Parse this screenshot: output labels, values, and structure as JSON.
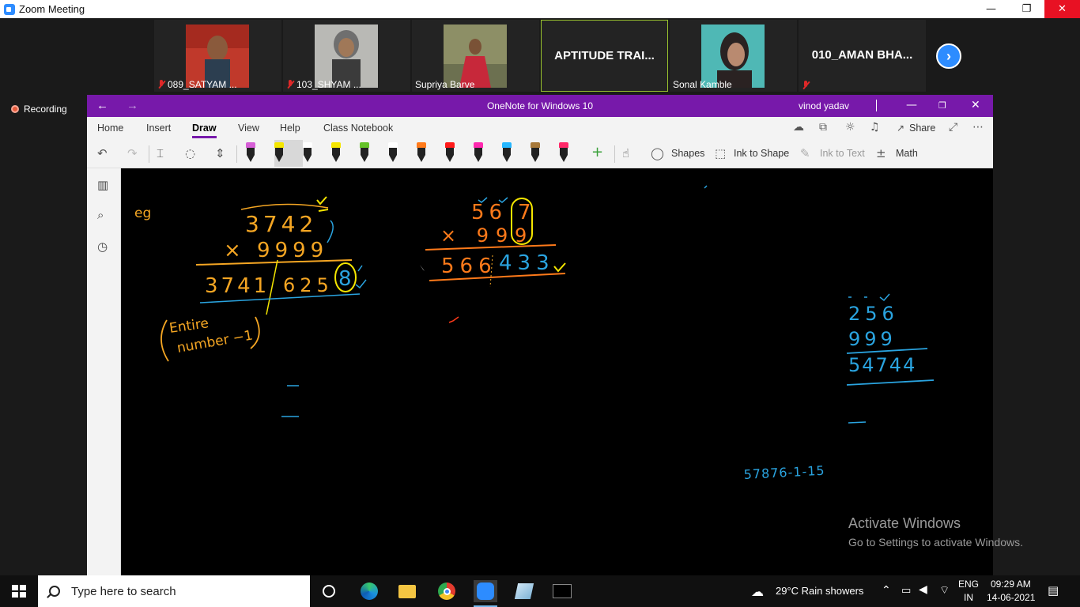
{
  "zoom": {
    "title": "Zoom Meeting",
    "recording": "Recording",
    "participants": [
      {
        "name": "089_SATYAM ...",
        "muted": true,
        "has_video": true
      },
      {
        "name": "103_SHYAM ...",
        "muted": true,
        "has_video": true
      },
      {
        "name": "Supriya Barve",
        "muted": false,
        "has_video": true
      },
      {
        "name": "APTITUDE TRAI...",
        "muted": false,
        "has_video": false
      },
      {
        "name": "Sonal Kamble",
        "muted": false,
        "has_video": true
      },
      {
        "name": "010_AMAN BHA...",
        "muted": true,
        "has_video": false
      }
    ]
  },
  "onenote": {
    "title": "OneNote for Windows 10",
    "user": "vinod yadav",
    "tabs": [
      "Home",
      "Insert",
      "Draw",
      "View",
      "Help",
      "Class Notebook"
    ],
    "active_tab": "Draw",
    "share_label": "Share",
    "tools": {
      "shapes": "Shapes",
      "ink_to_shape": "Ink to Shape",
      "ink_to_text": "Ink to Text",
      "math": "Math"
    },
    "pens": [
      "#d65fd6",
      "#f5e600",
      "#ffffff",
      "#f5e600",
      "#65c22a",
      "#ffffff",
      "#ff7a1a",
      "#ff1a1a",
      "#ff2ab0",
      "#26b7ff",
      "#a7793a",
      "#ff2a6a"
    ],
    "ink_notes": {
      "eg": "eg",
      "p1_top": "3742",
      "p1_mult": "× 9999",
      "p1_res_a": "3741",
      "p1_res_b": "625",
      "p1_res_c": "8",
      "p1_note1": "Entire",
      "p1_note2": "number −1",
      "p2_top_a": "56",
      "p2_top_b": "7",
      "p2_mult": "× 99",
      "p2_mult_b": "9",
      "p2_res_a": "566",
      "p2_res_b": "433",
      "p3_top": "256",
      "p3_mult": "999",
      "p3_res": "54744",
      "bottom": "57876-1-15"
    }
  },
  "activation": {
    "heading": "Activate Windows",
    "sub": "Go to Settings to activate Windows."
  },
  "taskbar": {
    "search_placeholder": "Type here to search",
    "weather": "29°C  Rain showers",
    "lang_top": "ENG",
    "lang_bottom": "IN",
    "time": "09:29 AM",
    "date": "14-06-2021"
  },
  "colors": {
    "onenote_purple": "#7719aa",
    "zoom_blue": "#2d8cff",
    "ink_orange": "#f5a623",
    "ink_blue": "#2aa4e0",
    "ink_yellow": "#f5e600"
  }
}
